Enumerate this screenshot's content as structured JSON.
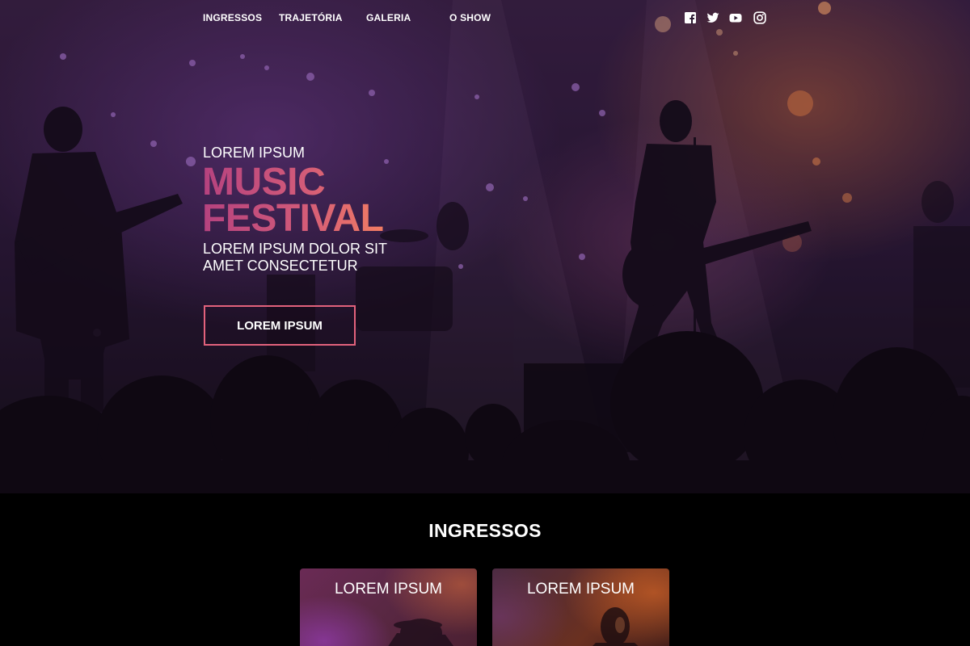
{
  "nav": {
    "items": [
      {
        "label": "INGRESSOS"
      },
      {
        "label": "TRAJETÓRIA"
      },
      {
        "label": "GALERIA"
      },
      {
        "label": "O SHOW"
      }
    ],
    "social": [
      "facebook-icon",
      "twitter-icon",
      "youtube-icon",
      "instagram-icon"
    ]
  },
  "hero": {
    "kicker": "LOREM IPSUM",
    "headline_line1": "MUSIC",
    "headline_line2": "FESTIVAL",
    "subtitle_line1": "LOREM IPSUM DOLOR SIT",
    "subtitle_line2": "AMET CONSECTETUR",
    "cta_label": "LOREM IPSUM"
  },
  "tickets": {
    "title": "INGRESSOS",
    "cards": [
      {
        "title": "LOREM IPSUM"
      },
      {
        "title": "LOREM IPSUM"
      }
    ]
  },
  "colors": {
    "accent_start": "#b5427f",
    "accent_end": "#f27d63",
    "button_border": "#e2627c",
    "section_background": "#000000"
  }
}
